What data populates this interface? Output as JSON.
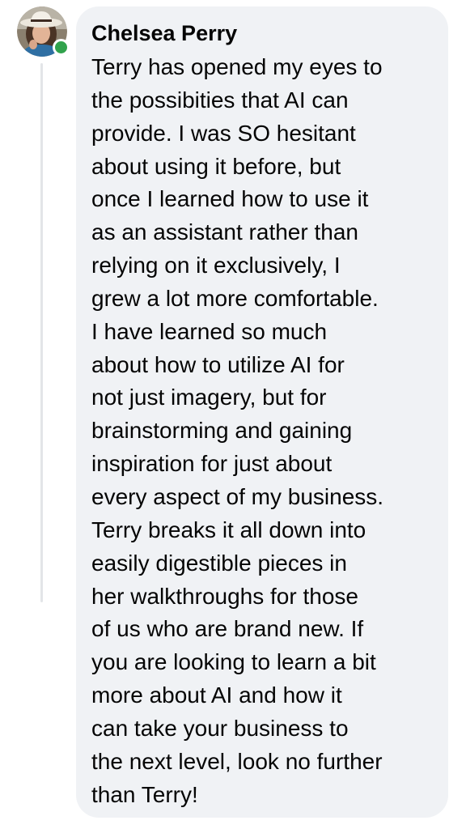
{
  "comment": {
    "author": "Chelsea Perry",
    "author_status_icon": "online-dot-icon",
    "lines": [
      "Terry has opened my eyes to",
      "the possibities that AI can",
      "provide. I was SO hesitant",
      "about using it before, but",
      "once I learned how to use it",
      "as an assistant rather than",
      "relying on it exclusively, I",
      "grew a lot more comfortable.",
      "I have learned so much",
      "about how to utilize AI for",
      "not just imagery, but for",
      "brainstorming and gaining",
      "inspiration for just about",
      "every aspect of my business.",
      "Terry breaks it all down into",
      "easily digestible pieces in",
      "her walkthroughs for those",
      "of us who are brand new. If",
      "you are looking to learn a bit",
      "more about AI and how it",
      "can take your business to",
      "the next level, look no further",
      "than Terry!"
    ]
  },
  "colors": {
    "bubble_background": "#f0f2f5",
    "text": "#050505",
    "online_indicator": "#31a24c",
    "thread_line": "#e3e5e8"
  }
}
